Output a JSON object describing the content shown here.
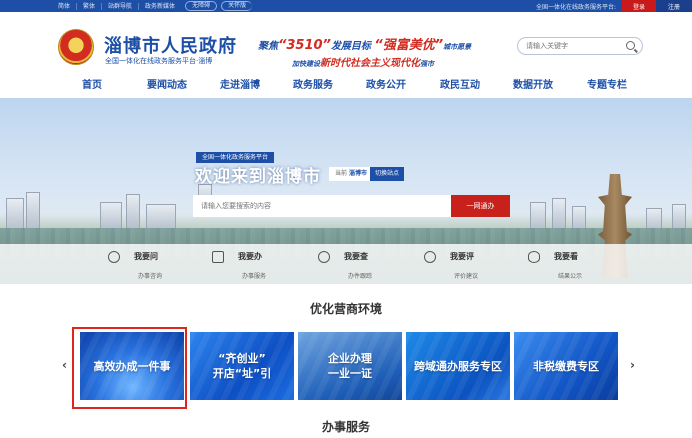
{
  "topbar": {
    "links": [
      "简体",
      "繁体",
      "站群导航",
      "政务新媒体"
    ],
    "pill1": "无障碍",
    "pill2": "关怀版",
    "platform": "全国一体化在线政务服务平台:",
    "login": "登录",
    "register": "注册"
  },
  "header": {
    "title": "淄博市人民政府",
    "subtitle": "全国一体化在线政务服务平台·淄博",
    "slogan1_pre": "聚焦",
    "slogan1_num": "“3510”",
    "slogan1_mid": "发展目标",
    "slogan1_red": "“强富美优”",
    "slogan1_post": "城市愿景",
    "slogan2_pre": "加快建设",
    "slogan2_red": "新时代社会主义现代化",
    "slogan2_post": "强市",
    "search_placeholder": "请输入关键字"
  },
  "nav": {
    "items": [
      "首页",
      "要闻动态",
      "走进淄博",
      "政务服务",
      "政务公开",
      "政民互动",
      "数据开放",
      "专题专栏"
    ]
  },
  "hero": {
    "platform_tag": "全国一体化政务服务平台",
    "welcome": "欢迎来到淄博市",
    "current_label": "当前",
    "current_city": "淄博市",
    "switch_label": "切换站点",
    "search_placeholder": "请输入您要搜索的内容",
    "search_button": "一网通办"
  },
  "quick": [
    {
      "title": "我要问",
      "sub": "办事咨询"
    },
    {
      "title": "我要办",
      "sub": "办事服务"
    },
    {
      "title": "我要查",
      "sub": "办件跟踪"
    },
    {
      "title": "我要评",
      "sub": "评价建议"
    },
    {
      "title": "我要看",
      "sub": "结果公示"
    }
  ],
  "section1": "优化营商环境",
  "cards": [
    {
      "l1": "高效办成一件事",
      "l2": ""
    },
    {
      "l1": "“齐创业”",
      "l2": "开店“址”引"
    },
    {
      "l1": "企业办理",
      "l2": "一业一证"
    },
    {
      "l1": "跨域通办服务专区",
      "l2": ""
    },
    {
      "l1": "非税缴费专区",
      "l2": ""
    }
  ],
  "section2": "办事服务",
  "arrows": {
    "prev": "‹",
    "next": "›"
  },
  "colors": {
    "brand_blue": "#1d4fa6",
    "accent_red": "#c8201a"
  }
}
